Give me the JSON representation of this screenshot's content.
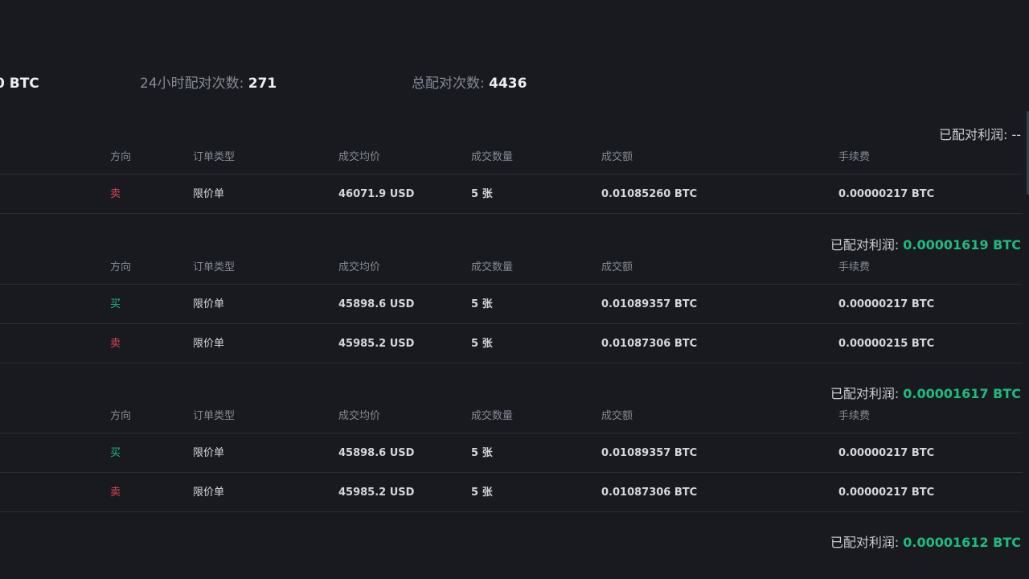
{
  "stats": {
    "left_value_suffix": "BTC",
    "left_value_prefix": "",
    "matches_24h_label": "24小时配对次数: ",
    "matches_24h_value": "271",
    "total_matches_label": "总配对次数: ",
    "total_matches_value": "4436"
  },
  "table_headers": {
    "direction": "方向",
    "order_type": "订单类型",
    "avg_price": "成交均价",
    "quantity": "成交数量",
    "amount": "成交额",
    "fee": "手续费"
  },
  "profit_label": "已配对利润: ",
  "groups": [
    {
      "profit": "--",
      "rows": [
        {
          "direction": "卖",
          "order_type": "限价单",
          "avg_price": "46071.9 USD",
          "quantity": "5 张",
          "amount": "0.01085260 BTC",
          "fee": "0.00000217 BTC"
        }
      ]
    },
    {
      "profit": "0.00001619 BTC",
      "rows": [
        {
          "direction": "买",
          "order_type": "限价单",
          "avg_price": "45898.6 USD",
          "quantity": "5 张",
          "amount": "0.01089357 BTC",
          "fee": "0.00000217 BTC"
        },
        {
          "direction": "卖",
          "order_type": "限价单",
          "avg_price": "45985.2 USD",
          "quantity": "5 张",
          "amount": "0.01087306 BTC",
          "fee": "0.00000215 BTC"
        }
      ]
    },
    {
      "profit": "0.00001617 BTC",
      "rows": [
        {
          "direction": "买",
          "order_type": "限价单",
          "avg_price": "45898.6 USD",
          "quantity": "5 张",
          "amount": "0.01089357 BTC",
          "fee": "0.00000217 BTC"
        },
        {
          "direction": "卖",
          "order_type": "限价单",
          "avg_price": "45985.2 USD",
          "quantity": "5 张",
          "amount": "0.01087306 BTC",
          "fee": "0.00000217 BTC"
        }
      ]
    },
    {
      "profit": "0.00001612 BTC",
      "rows": []
    }
  ],
  "colors": {
    "background": "#181a20",
    "sell": "#e0454f",
    "buy": "#1ebb7f",
    "profit_positive": "#1ebb7f"
  }
}
